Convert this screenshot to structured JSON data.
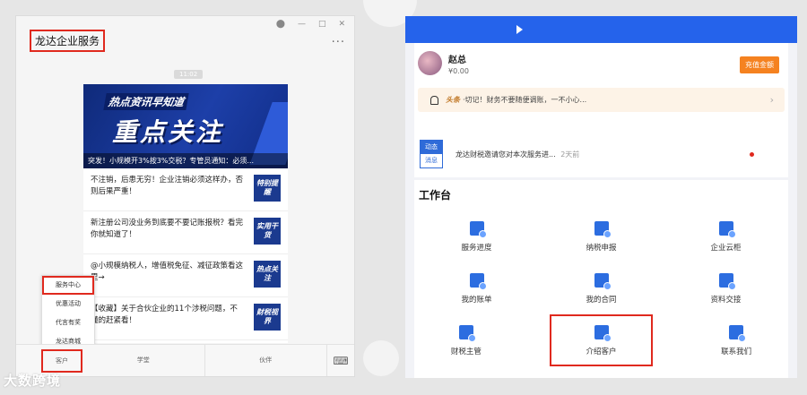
{
  "wechat": {
    "title": "龙达企业服务",
    "more": "···",
    "time": "11:02",
    "banner": {
      "kicker": "热点资讯早知道",
      "main": "重点关注",
      "caption": "突发！小规模开3%按3%交税？专管员通知：必须..."
    },
    "articles": [
      {
        "text": "不注销，后患无穷！企业注销必须这样办，否则后果严重！",
        "thumb": "特别提醒"
      },
      {
        "text": "新注册公司没业务到底要不要记账报税？看完你就知道了！",
        "thumb": "实用干货"
      },
      {
        "text": "@小规模纳税人，增值税免征、减征政策看这里→",
        "thumb": "热点关注"
      },
      {
        "text": "【收藏】关于合伙企业的11个涉税问题，不懂的赶紧看！",
        "thumb": "财税视界"
      }
    ],
    "popup": [
      "服务中心",
      "优惠活动",
      "代言有奖",
      "龙达商城"
    ],
    "menu": [
      "客户",
      "学堂",
      "伙伴"
    ]
  },
  "watermark": "大数跨境",
  "app": {
    "user": {
      "name": "赵总",
      "balance": "¥0.00",
      "recharge": "充值金额"
    },
    "notice": {
      "tag": "头条",
      "text": "·切记！财务不要随便调账，一不小心..."
    },
    "news": {
      "badge_top": "动态",
      "badge_bottom": "消息",
      "text": "龙达财税邀请您对本次服务进...",
      "time": "2天前"
    },
    "workbench": {
      "title": "工作台",
      "items": [
        [
          "服务进度",
          "纳税申报",
          "企业云柜"
        ],
        [
          "我的账单",
          "我的合同",
          "资料交接"
        ],
        [
          "财税主管",
          "介绍客户",
          "联系我们"
        ]
      ]
    }
  },
  "colors": {
    "brand_blue": "#2563eb",
    "highlight_red": "#e0291e",
    "orange": "#f58220"
  }
}
